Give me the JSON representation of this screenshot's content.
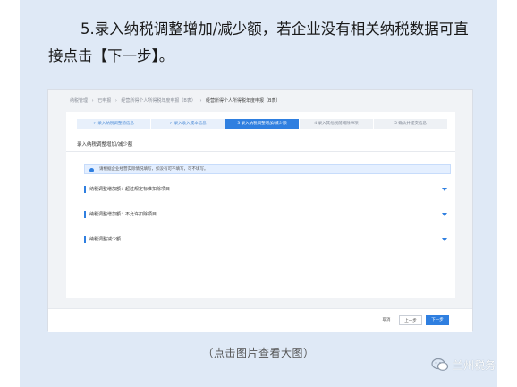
{
  "instruction": {
    "line1": "5.录入纳税调整增加/减少额，若企业没有相关纳税数据可直",
    "line2": "接点击【下一步】。"
  },
  "screenshot": {
    "breadcrumb": [
      "纳税管理",
      "›",
      "已申报",
      "›",
      "经营所得个人所得税年度申报（B表）",
      "›",
      "经营所得个人所得税年度申报（B表）"
    ],
    "steps": [
      {
        "label": "✓ 录入纳税调整前信息",
        "state": "done"
      },
      {
        "label": "✓ 录入收入成本信息",
        "state": "done"
      },
      {
        "label": "3 录入纳税调整增加/减少额",
        "state": "active"
      },
      {
        "label": "4 录入其他税前减除事项",
        "state": "todo"
      },
      {
        "label": "5 确认并提交信息",
        "state": "todo"
      }
    ],
    "section_title": "录入纳税调整增加/减少额",
    "notice": "请根据企业经营实际情况填写，如没有可不填写，可不填写。",
    "rows": [
      {
        "label": "纳税调整增加额：超过规定标准扣除项目"
      },
      {
        "label": "纳税调整增加额：不允许扣除项目"
      },
      {
        "label": "纳税调整减少额"
      }
    ],
    "buttons": {
      "cancel": "取消",
      "prev": "上一步",
      "next": "下一步"
    },
    "colors": {
      "accent": "#2f7fe0",
      "background": "#dfe9f6"
    }
  },
  "caption": "（点击图片查看大图）",
  "watermark": {
    "text": "兰州税务",
    "icon": "wechat-icon"
  }
}
